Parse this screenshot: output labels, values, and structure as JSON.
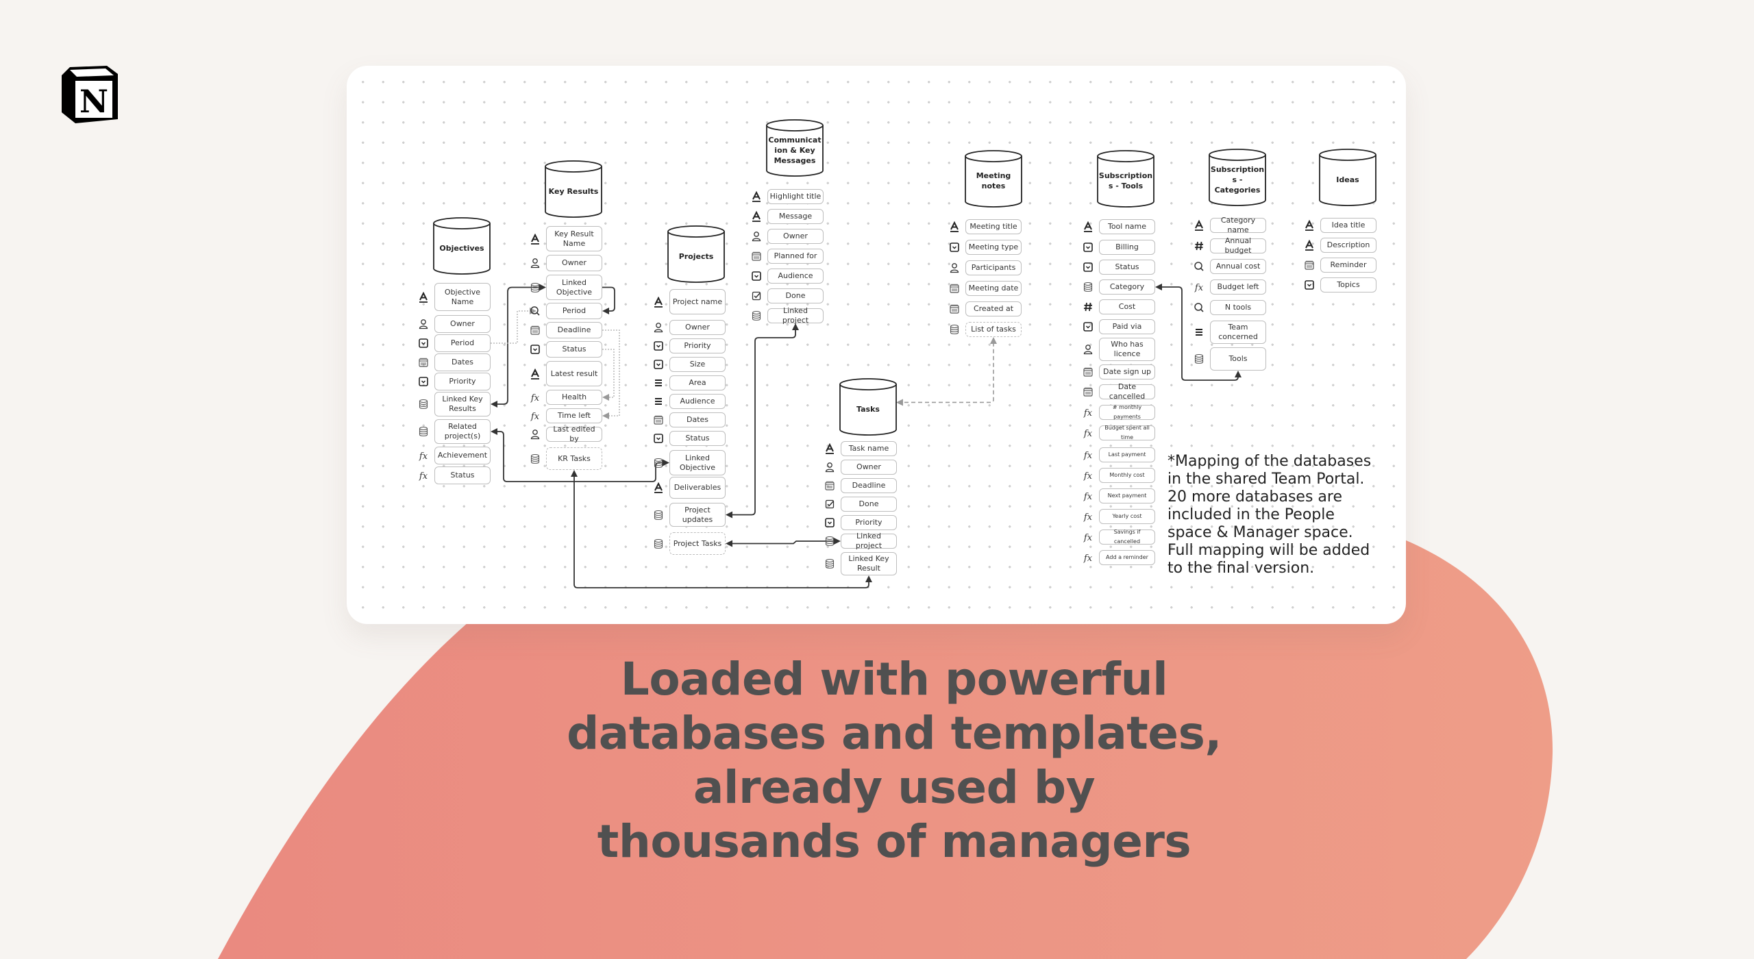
{
  "colors": {
    "background": "#f7f4f1",
    "blob_left": "#ea8a80",
    "blob_right": "#ee9d88",
    "card": "#ffffff",
    "headline": "#505050",
    "line": "#333333"
  },
  "logo": {
    "name": "notion-logo",
    "glyph": "N"
  },
  "headline": {
    "lines": [
      "Loaded with powerful",
      "databases and templates,",
      "already used by",
      "thousands of managers"
    ]
  },
  "note": "*Mapping of the databases\nin the shared Team Portal.\n20 more databases are\nincluded in the People\nspace & Manager space.\nFull mapping will be added\nto the final version.",
  "databases": [
    {
      "id": "objectives",
      "title": "Objectives",
      "fields": [
        {
          "label": "Objective Name",
          "icon": "text"
        },
        {
          "label": "Owner",
          "icon": "person"
        },
        {
          "label": "Period",
          "icon": "select"
        },
        {
          "label": "Dates",
          "icon": "calendar"
        },
        {
          "label": "Priority",
          "icon": "select"
        },
        {
          "label": "Linked Key Results",
          "icon": "relation"
        },
        {
          "label": "Related project(s)",
          "icon": "relation"
        },
        {
          "label": "Achievement",
          "icon": "formula"
        },
        {
          "label": "Status",
          "icon": "formula"
        }
      ]
    },
    {
      "id": "key-results",
      "title": "Key Results",
      "fields": [
        {
          "label": "Key Result Name",
          "icon": "text"
        },
        {
          "label": "Owner",
          "icon": "person"
        },
        {
          "label": "Linked Objective",
          "icon": "relation"
        },
        {
          "label": "Period",
          "icon": "rollup"
        },
        {
          "label": "Deadline",
          "icon": "calendar"
        },
        {
          "label": "Status",
          "icon": "select"
        },
        {
          "label": "Latest result",
          "icon": "text"
        },
        {
          "label": "Health",
          "icon": "formula"
        },
        {
          "label": "Time left",
          "icon": "formula"
        },
        {
          "label": "Last edited by",
          "icon": "person"
        },
        {
          "label": "KR Tasks",
          "icon": "relation",
          "dashed": true
        }
      ]
    },
    {
      "id": "projects",
      "title": "Projects",
      "fields": [
        {
          "label": "Project name",
          "icon": "text"
        },
        {
          "label": "Owner",
          "icon": "person"
        },
        {
          "label": "Priority",
          "icon": "select"
        },
        {
          "label": "Size",
          "icon": "select"
        },
        {
          "label": "Area",
          "icon": "multiselect"
        },
        {
          "label": "Audience",
          "icon": "multiselect"
        },
        {
          "label": "Dates",
          "icon": "calendar"
        },
        {
          "label": "Status",
          "icon": "select"
        },
        {
          "label": "Linked Objective",
          "icon": "relation"
        },
        {
          "label": "Deliverables",
          "icon": "text"
        },
        {
          "label": "Project updates",
          "icon": "relation"
        },
        {
          "label": "Project Tasks",
          "icon": "relation",
          "dashed": true
        }
      ]
    },
    {
      "id": "communication",
      "title": "Communication & Key Messages",
      "title_lines": [
        "Communicat",
        "ion & Key",
        "Messages"
      ],
      "fields": [
        {
          "label": "Highlight title",
          "icon": "text"
        },
        {
          "label": "Message",
          "icon": "text"
        },
        {
          "label": "Owner",
          "icon": "person"
        },
        {
          "label": "Planned for",
          "icon": "calendar"
        },
        {
          "label": "Audience",
          "icon": "select"
        },
        {
          "label": "Done",
          "icon": "checkbox"
        },
        {
          "label": "Linked project",
          "icon": "relation"
        }
      ]
    },
    {
      "id": "tasks",
      "title": "Tasks",
      "fields": [
        {
          "label": "Task name",
          "icon": "text"
        },
        {
          "label": "Owner",
          "icon": "person"
        },
        {
          "label": "Deadline",
          "icon": "calendar"
        },
        {
          "label": "Done",
          "icon": "checkbox"
        },
        {
          "label": "Priority",
          "icon": "select"
        },
        {
          "label": "Linked project",
          "icon": "relation"
        },
        {
          "label": "Linked Key Result",
          "icon": "relation"
        }
      ]
    },
    {
      "id": "meeting-notes",
      "title": "Meeting notes",
      "fields": [
        {
          "label": "Meeting title",
          "icon": "text"
        },
        {
          "label": "Meeting type",
          "icon": "select"
        },
        {
          "label": "Participants",
          "icon": "person"
        },
        {
          "label": "Meeting date",
          "icon": "calendar"
        },
        {
          "label": "Created at",
          "icon": "calendar"
        },
        {
          "label": "List of tasks",
          "icon": "relation",
          "dashed": true
        }
      ]
    },
    {
      "id": "subscriptions-tools",
      "title": "Subscriptions - Tools",
      "title_lines": [
        "Subscription",
        "s - Tools"
      ],
      "fields": [
        {
          "label": "Tool name",
          "icon": "text"
        },
        {
          "label": "Billing",
          "icon": "select"
        },
        {
          "label": "Status",
          "icon": "select"
        },
        {
          "label": "Category",
          "icon": "relation"
        },
        {
          "label": "Cost",
          "icon": "number"
        },
        {
          "label": "Paid via",
          "icon": "select"
        },
        {
          "label": "Who has licence",
          "icon": "person"
        },
        {
          "label": "Date sign up",
          "icon": "calendar"
        },
        {
          "label": "Date cancelled",
          "icon": "calendar"
        },
        {
          "label": "# monthly payments",
          "icon": "formula",
          "small": true
        },
        {
          "label": "Budget spent all time",
          "icon": "formula",
          "small": true
        },
        {
          "label": "Last payment",
          "icon": "formula",
          "small": true
        },
        {
          "label": "Monthly cost",
          "icon": "formula",
          "small": true
        },
        {
          "label": "Next payment",
          "icon": "formula",
          "small": true
        },
        {
          "label": "Yearly cost",
          "icon": "formula",
          "small": true
        },
        {
          "label": "Savings if cancelled",
          "icon": "formula",
          "small": true
        },
        {
          "label": "Add a reminder",
          "icon": "formula",
          "small": true
        }
      ]
    },
    {
      "id": "subscriptions-categories",
      "title": "Subscriptions - Categories",
      "title_lines": [
        "Subscription",
        "s - Categories"
      ],
      "fields": [
        {
          "label": "Category name",
          "icon": "text"
        },
        {
          "label": "Annual budget",
          "icon": "number"
        },
        {
          "label": "Annual cost",
          "icon": "rollup"
        },
        {
          "label": "Budget left",
          "icon": "formula"
        },
        {
          "label": "N tools",
          "icon": "rollup"
        },
        {
          "label": "Team concerned",
          "icon": "multiselect"
        },
        {
          "label": "Tools",
          "icon": "relation"
        }
      ]
    },
    {
      "id": "ideas",
      "title": "Ideas",
      "fields": [
        {
          "label": "Idea title",
          "icon": "text"
        },
        {
          "label": "Description",
          "icon": "text"
        },
        {
          "label": "Reminder",
          "icon": "calendar"
        },
        {
          "label": "Topics",
          "icon": "select"
        }
      ]
    }
  ],
  "relations": [
    {
      "from": "objectives.Linked Key Results",
      "to": "key-results.Linked Objective",
      "style": "solid",
      "bidirectional": true
    },
    {
      "from": "key-results.Linked Objective",
      "to": "key-results.Period",
      "style": "solid"
    },
    {
      "from": "objectives.Period",
      "to": "key-results.Period",
      "style": "dotted"
    },
    {
      "from": "key-results.Status",
      "to": "key-results.Health",
      "style": "dotted"
    },
    {
      "from": "key-results.Deadline",
      "to": "key-results.Time left",
      "style": "dotted"
    },
    {
      "from": "projects.Linked Objective",
      "to": "objectives.Related project(s)",
      "style": "solid",
      "bidirectional": true
    },
    {
      "from": "communication.Linked project",
      "to": "projects.Project updates",
      "style": "solid",
      "bidirectional": true
    },
    {
      "from": "tasks.Linked project",
      "to": "projects.Project Tasks",
      "style": "solid",
      "bidirectional": true
    },
    {
      "from": "tasks.Linked Key Result",
      "to": "key-results.KR Tasks",
      "style": "solid",
      "bidirectional": true
    },
    {
      "from": "meeting-notes.List of tasks",
      "to": "tasks",
      "style": "dashed",
      "bidirectional": true
    },
    {
      "from": "subscriptions-categories.Tools",
      "to": "subscriptions-tools.Category",
      "style": "solid",
      "bidirectional": true
    }
  ]
}
